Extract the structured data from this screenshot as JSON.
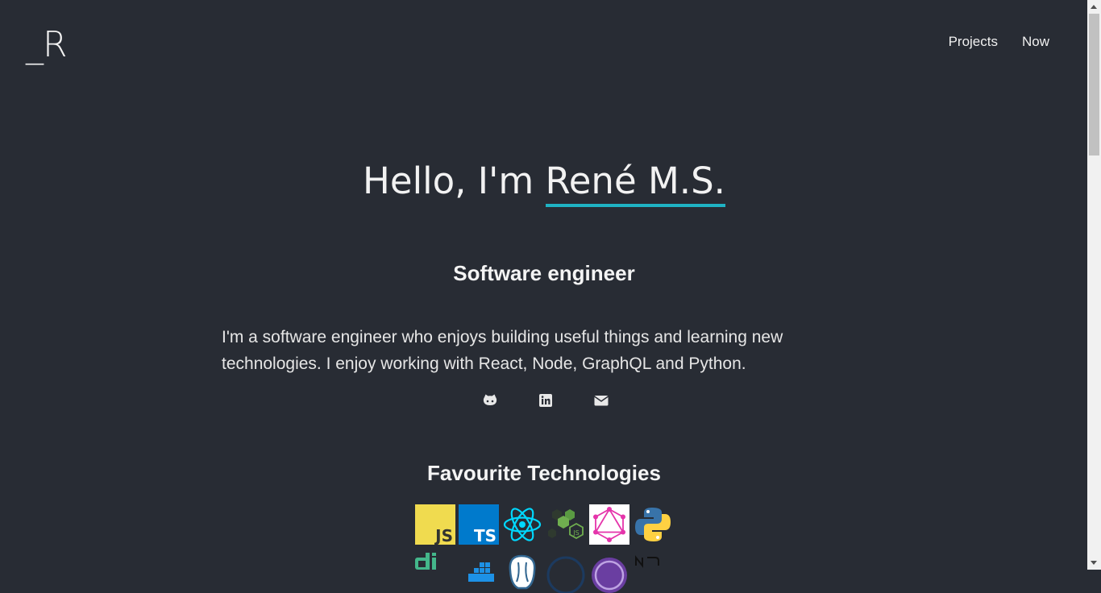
{
  "header": {
    "logo": "_R",
    "nav": [
      {
        "label": "Projects"
      },
      {
        "label": "Now"
      }
    ]
  },
  "hero": {
    "greeting": "Hello, I'm ",
    "name": "René M.S.",
    "subtitle": "Software engineer",
    "bio": "I'm a software engineer who enjoys building useful things and learning new technologies. I enjoy working with React, Node, GraphQL and Python.",
    "accent_color": "#1fb3c4"
  },
  "socials": [
    {
      "icon": "github-icon"
    },
    {
      "icon": "linkedin-icon"
    },
    {
      "icon": "envelope-icon"
    }
  ],
  "technologies": {
    "title": "Favourite Technologies",
    "row1": [
      "javascript",
      "typescript",
      "react",
      "nodejs",
      "graphql",
      "python"
    ],
    "row2": [
      "django",
      "docker",
      "postgresql",
      "unknown",
      "apollo",
      "nextjs"
    ],
    "badges": {
      "js": "JS",
      "ts": "TS"
    }
  }
}
